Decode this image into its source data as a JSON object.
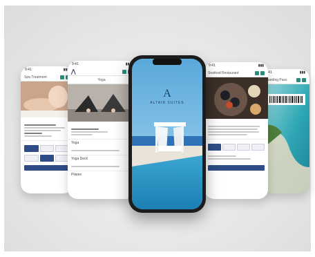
{
  "scene": {
    "brand_name": "ALTAIR SUITES",
    "colors": {
      "accent": "#2e4d86",
      "teal": "#2a8c7c",
      "backdrop": "#e6e6e6"
    }
  },
  "phones": {
    "far_left": {
      "screen_title": "Spa Treatment",
      "icon": "massage-photo"
    },
    "mid_left": {
      "screen_title": "Yoga",
      "sections": [
        "Yoga",
        "Yoga Deck",
        "Pilates"
      ]
    },
    "center": {
      "brand": "ALTAIR SUITES",
      "logo_letter": "A"
    },
    "mid_right": {
      "screen_title": "Seafood Restaurant",
      "icon": "seafood-photo"
    },
    "far_right": {
      "screen_title": "Boarding Pass",
      "icon": "barcode-icon"
    }
  }
}
